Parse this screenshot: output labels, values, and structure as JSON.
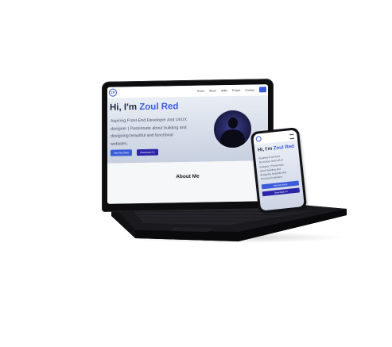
{
  "site": {
    "logo_text": "ZR",
    "nav": [
      "Home",
      "About",
      "Skills",
      "Project",
      "Contact"
    ],
    "hero": {
      "greeting": "Hi, I'm",
      "name": "Zoul Red",
      "description": "Aspiring Front-End Developer And UI/UX designer | Passionate about building and designing beautiful and functional websites.",
      "primary_button": "View My Work",
      "secondary_button": "Download CV"
    },
    "about": {
      "title": "About Me"
    }
  },
  "phone": {
    "greeting": "Hi, I'm",
    "name": "Zoul Red",
    "description": "Aspiring Front-End Developer And UI/UX designer | Passionate about building and designing beautiful and functional websites.",
    "primary_button": "View My Work",
    "secondary_button": "Download CV"
  },
  "colors": {
    "accent": "#3b5bdb",
    "secondary": "#2a24a8",
    "laptop_body": "#0d0d0f"
  }
}
